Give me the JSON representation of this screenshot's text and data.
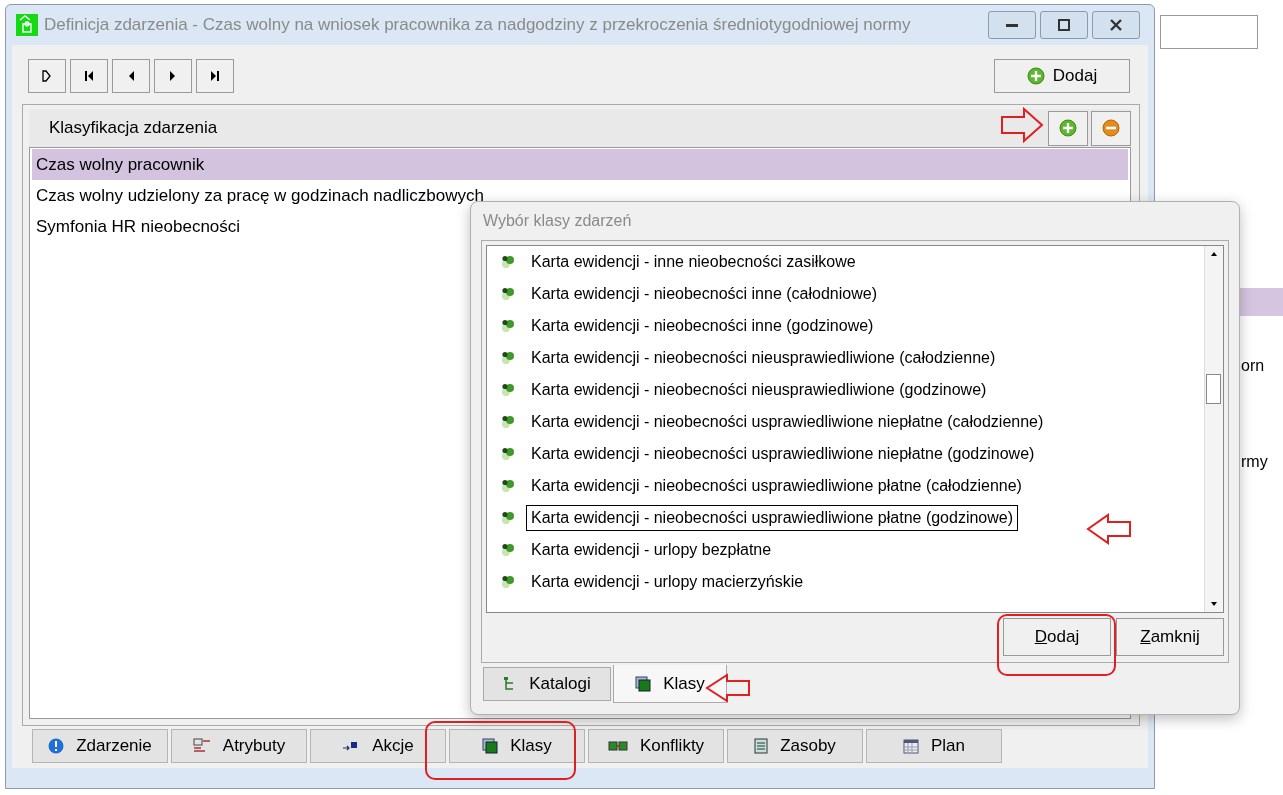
{
  "background": {
    "fragments": [
      "orn",
      "rmy"
    ]
  },
  "main_window": {
    "title": "Definicja zdarzenia - Czas wolny na wniosek pracownika za nadgodziny z przekroczenia średniotygodniowej normy",
    "add_button": "Dodaj",
    "classification": {
      "title": "Klasyfikacja zdarzenia",
      "items": [
        {
          "label": "Czas wolny pracownik",
          "selected": true
        },
        {
          "label": "Czas wolny udzielony za pracę w godzinach nadliczbowych",
          "selected": false
        },
        {
          "label": "Symfonia HR nieobecności",
          "selected": false
        }
      ]
    },
    "tabs": [
      {
        "label": "Zdarzenie",
        "kind": "info"
      },
      {
        "label": "Atrybuty",
        "kind": "attributes"
      },
      {
        "label": "Akcje",
        "kind": "actions"
      },
      {
        "label": "Klasy",
        "kind": "classes"
      },
      {
        "label": "Konflikty",
        "kind": "conflicts"
      },
      {
        "label": "Zasoby",
        "kind": "resources"
      },
      {
        "label": "Plan",
        "kind": "calendar"
      }
    ]
  },
  "dialog": {
    "title": "Wybór klasy zdarzeń",
    "items": [
      {
        "label": "Karta ewidencji - inne nieobecności zasiłkowe",
        "focused": false
      },
      {
        "label": "Karta ewidencji - nieobecności inne (całodniowe)",
        "focused": false
      },
      {
        "label": "Karta ewidencji - nieobecności inne (godzinowe)",
        "focused": false
      },
      {
        "label": "Karta ewidencji - nieobecności nieusprawiedliwione (całodzienne)",
        "focused": false
      },
      {
        "label": "Karta ewidencji - nieobecności nieusprawiedliwione (godzinowe)",
        "focused": false
      },
      {
        "label": "Karta ewidencji - nieobecności usprawiedliwione niepłatne (całodzienne)",
        "focused": false
      },
      {
        "label": "Karta ewidencji - nieobecności usprawiedliwione niepłatne (godzinowe)",
        "focused": false
      },
      {
        "label": "Karta ewidencji - nieobecności usprawiedliwione płatne (całodzienne)",
        "focused": false
      },
      {
        "label": "Karta ewidencji - nieobecności usprawiedliwione płatne (godzinowe)",
        "focused": true
      },
      {
        "label": "Karta ewidencji - urlopy bezpłatne",
        "focused": false
      },
      {
        "label": "Karta ewidencji - urlopy macierzyńskie",
        "focused": false
      }
    ],
    "buttons": [
      "Dodaj",
      "Zamknij"
    ],
    "tabs": [
      {
        "label": "Katalogi",
        "kind": "tree",
        "selected": false
      },
      {
        "label": "Klasy",
        "kind": "classes",
        "selected": true
      }
    ]
  }
}
